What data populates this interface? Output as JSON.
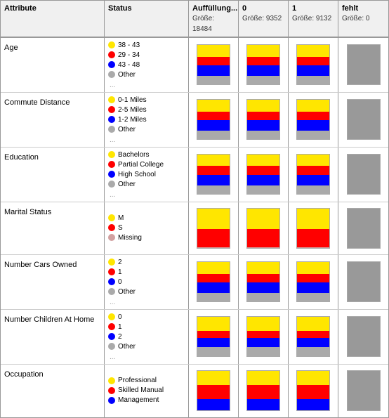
{
  "header": {
    "attribute_label": "Attribute",
    "status_label": "Status",
    "cols": [
      {
        "id": "auffuellung",
        "label": "Auffüllung...",
        "sub": "Größe: 18484"
      },
      {
        "id": "col0",
        "label": "0",
        "sub": "Größe: 9352"
      },
      {
        "id": "col1",
        "label": "1",
        "sub": "Größe: 9132"
      },
      {
        "id": "fehlt",
        "label": "fehlt",
        "sub": "Größe: 0"
      }
    ]
  },
  "rows": [
    {
      "attribute": "Age",
      "status_items": [
        {
          "color": "yellow",
          "label": "38 - 43"
        },
        {
          "color": "red",
          "label": "29 - 34"
        },
        {
          "color": "blue",
          "label": "43 - 48"
        },
        {
          "color": "gray",
          "label": "Other"
        }
      ],
      "has_ellipsis": true,
      "bars": [
        {
          "type": "colored",
          "segments": [
            30,
            20,
            25,
            25
          ]
        },
        {
          "type": "colored",
          "segments": [
            30,
            20,
            25,
            25
          ]
        },
        {
          "type": "colored",
          "segments": [
            30,
            20,
            25,
            25
          ]
        }
      ]
    },
    {
      "attribute": "Commute Distance",
      "status_items": [
        {
          "color": "yellow",
          "label": "0-1 Miles"
        },
        {
          "color": "red",
          "label": "2-5 Miles"
        },
        {
          "color": "blue",
          "label": "1-2 Miles"
        },
        {
          "color": "gray",
          "label": "Other"
        }
      ],
      "has_ellipsis": true,
      "bars": [
        {
          "type": "colored",
          "segments": [
            30,
            20,
            25,
            25
          ]
        },
        {
          "type": "colored",
          "segments": [
            30,
            20,
            25,
            25
          ]
        },
        {
          "type": "colored",
          "segments": [
            30,
            20,
            25,
            25
          ]
        }
      ]
    },
    {
      "attribute": "Education",
      "status_items": [
        {
          "color": "yellow",
          "label": "Bachelors"
        },
        {
          "color": "red",
          "label": "Partial College"
        },
        {
          "color": "blue",
          "label": "High School"
        },
        {
          "color": "gray",
          "label": "Other"
        }
      ],
      "has_ellipsis": true,
      "bars": [
        {
          "type": "colored",
          "segments": [
            28,
            22,
            25,
            25
          ]
        },
        {
          "type": "colored",
          "segments": [
            28,
            22,
            25,
            25
          ]
        },
        {
          "type": "colored",
          "segments": [
            28,
            22,
            25,
            25
          ]
        }
      ]
    },
    {
      "attribute": "Marital Status",
      "status_items": [
        {
          "color": "yellow",
          "label": "M"
        },
        {
          "color": "red",
          "label": "S"
        },
        {
          "color": "pink",
          "label": "Missing"
        }
      ],
      "has_ellipsis": false,
      "bars": [
        {
          "type": "colored_marital",
          "segments": [
            50,
            45,
            5
          ]
        },
        {
          "type": "colored_marital",
          "segments": [
            50,
            45,
            5
          ]
        },
        {
          "type": "colored_marital",
          "segments": [
            50,
            45,
            5
          ]
        }
      ]
    },
    {
      "attribute": "Number Cars Owned",
      "status_items": [
        {
          "color": "yellow",
          "label": "2"
        },
        {
          "color": "red",
          "label": "1"
        },
        {
          "color": "blue",
          "label": "0"
        },
        {
          "color": "gray",
          "label": "Other"
        }
      ],
      "has_ellipsis": true,
      "bars": [
        {
          "type": "colored",
          "segments": [
            30,
            20,
            25,
            25
          ]
        },
        {
          "type": "colored",
          "segments": [
            30,
            20,
            25,
            25
          ]
        },
        {
          "type": "colored",
          "segments": [
            30,
            20,
            25,
            25
          ]
        }
      ]
    },
    {
      "attribute": "Number Children At Home",
      "status_items": [
        {
          "color": "yellow",
          "label": "0"
        },
        {
          "color": "red",
          "label": "1"
        },
        {
          "color": "blue",
          "label": "2"
        },
        {
          "color": "gray",
          "label": "Other"
        }
      ],
      "has_ellipsis": true,
      "bars": [
        {
          "type": "colored",
          "segments": [
            35,
            18,
            22,
            25
          ]
        },
        {
          "type": "colored",
          "segments": [
            35,
            18,
            22,
            25
          ]
        },
        {
          "type": "colored",
          "segments": [
            35,
            18,
            22,
            25
          ]
        }
      ]
    },
    {
      "attribute": "Occupation",
      "status_items": [
        {
          "color": "yellow",
          "label": "Professional"
        },
        {
          "color": "red",
          "label": "Skilled Manual"
        },
        {
          "color": "blue",
          "label": "Management"
        }
      ],
      "has_ellipsis": false,
      "bars": [
        {
          "type": "colored_occ",
          "segments": [
            35,
            35,
            30
          ]
        },
        {
          "type": "colored_occ",
          "segments": [
            35,
            35,
            30
          ]
        },
        {
          "type": "colored_occ",
          "segments": [
            35,
            35,
            30
          ]
        }
      ]
    }
  ],
  "colors": {
    "yellow": "#FFE600",
    "red": "#FF0000",
    "blue": "#0000FF",
    "gray": "#AAAAAA",
    "pink": "#D2A0A0"
  }
}
